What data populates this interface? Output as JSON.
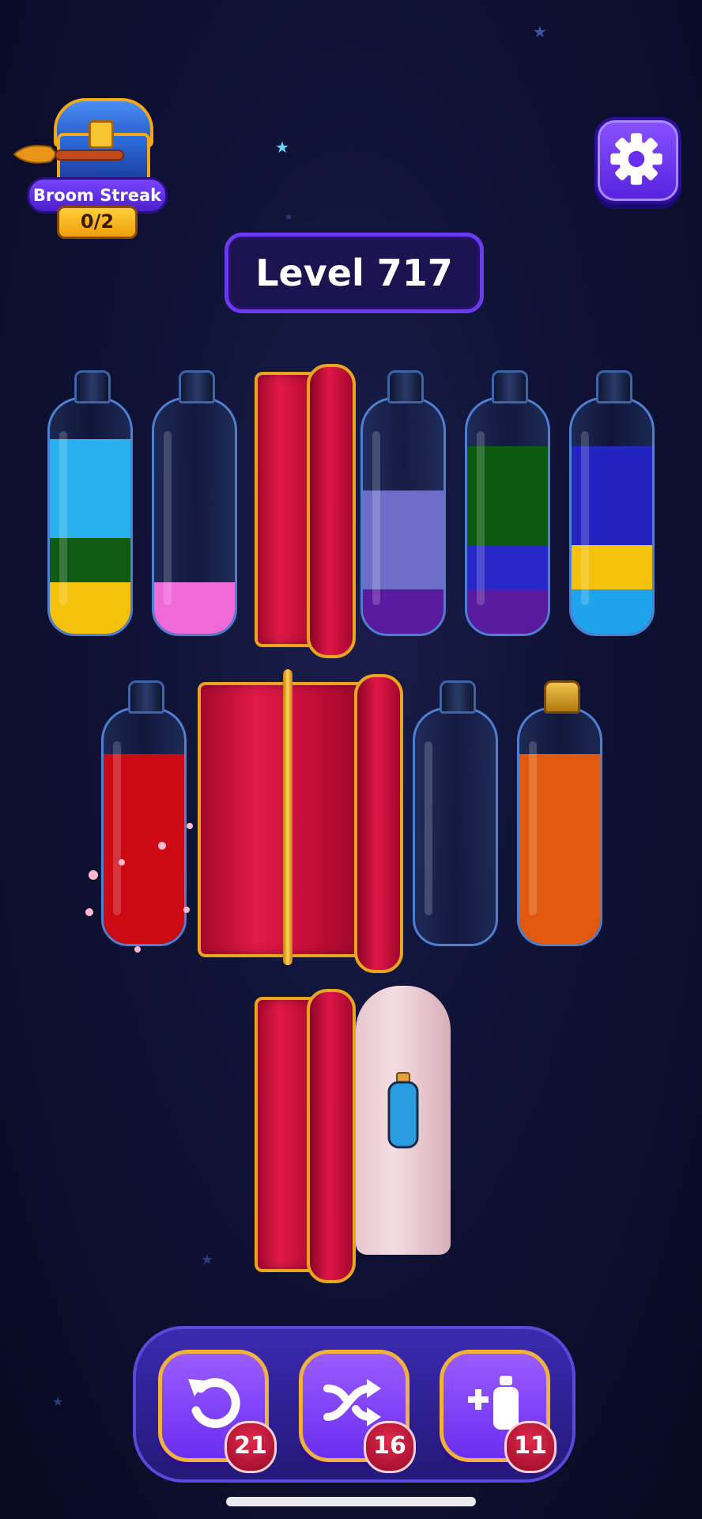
{
  "streak": {
    "label": "Broom Streak",
    "count": "0/2"
  },
  "level": {
    "label": "Level 717"
  },
  "settings": {
    "icon": "gear-icon"
  },
  "bottles": [
    {
      "id": "b1",
      "layers": [
        "#f4c20d",
        "#0f5a12",
        "#29b0ee"
      ],
      "fill": [
        0.22,
        0.19,
        0.42
      ]
    },
    {
      "id": "b2",
      "layers": [
        "#f06ad8"
      ],
      "fill": [
        0.22
      ]
    },
    {
      "id": "b4",
      "layers": [
        "#5a1aa0",
        "#6e6ec8"
      ],
      "fill": [
        0.19,
        0.42
      ]
    },
    {
      "id": "b5",
      "layers": [
        "#5a1aa0",
        "#2828c8",
        "#0b5a10"
      ],
      "fill": [
        0.19,
        0.19,
        0.42
      ]
    },
    {
      "id": "b6",
      "layers": [
        "#1fa4ec",
        "#f4c20d",
        "#2424c0"
      ],
      "fill": [
        0.19,
        0.19,
        0.42
      ]
    },
    {
      "id": "b7",
      "layers": [
        "#cc0a14"
      ],
      "fill": [
        0.81
      ]
    },
    {
      "id": "b8",
      "layers": [],
      "fill": []
    },
    {
      "id": "b9",
      "layers": [
        "#e0590c"
      ],
      "fill": [
        0.81
      ],
      "corked": true
    }
  ],
  "hidden_bottle": {
    "icon": "bottle-icon",
    "inner_color": "#2a9ee0"
  },
  "tools": [
    {
      "name": "undo",
      "icon": "undo-icon",
      "count": "21"
    },
    {
      "name": "shuffle",
      "icon": "shuffle-icon",
      "count": "16"
    },
    {
      "name": "add-bottle",
      "icon": "add-bottle-icon",
      "count": "11"
    }
  ]
}
